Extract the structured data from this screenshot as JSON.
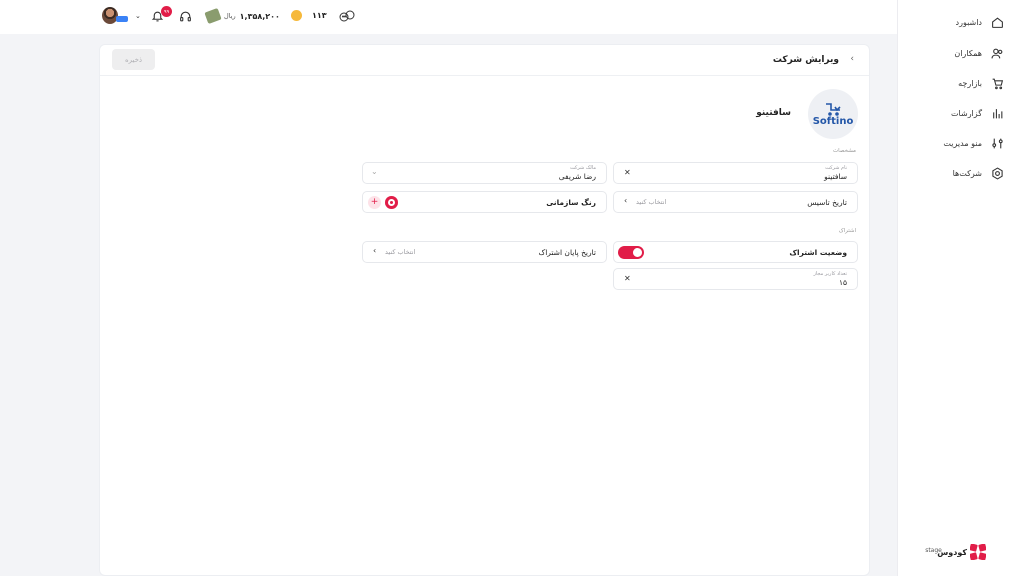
{
  "sidebar": {
    "items": [
      {
        "label": "داشبورد",
        "icon": "home-icon"
      },
      {
        "label": "همکاران",
        "icon": "users-icon"
      },
      {
        "label": "بازارچه",
        "icon": "cart-icon"
      },
      {
        "label": "گزارشات",
        "icon": "chart-icon"
      },
      {
        "label": "منو مدیریت",
        "icon": "sliders-icon"
      },
      {
        "label": "شرکت‌ها",
        "icon": "settings-icon"
      }
    ],
    "brand": "کودوس",
    "brand_tag": "stage"
  },
  "topbar": {
    "coins": "۱۱۳",
    "balance": "۱,۳۵۸,۲۰۰",
    "currency": "ریال",
    "notification_count": "۹۹"
  },
  "page": {
    "title": "ویرایش شرکت",
    "save_label": "ذخیره",
    "company_name": "سافتینو",
    "logo_text": "Softino",
    "section_details": "مشخصات",
    "section_subscription": "اشتراک"
  },
  "fields": {
    "company_name": {
      "label": "نام شرکت",
      "value": "سافتینو"
    },
    "owner": {
      "label": "مالک شرکت",
      "value": "رضا شریفی"
    },
    "founded": {
      "title": "تاریخ تاسیس",
      "placeholder": "انتخاب کنید"
    },
    "brand_color": {
      "title": "رنگ سازمانی",
      "color": "#e11d48"
    },
    "subscription_status": {
      "title": "وضعیت اشتراک",
      "enabled": true
    },
    "subscription_end": {
      "title": "تاریخ پایان اشتراک",
      "placeholder": "انتخاب کنید"
    },
    "user_limit": {
      "label": "تعداد کاربر مجاز",
      "value": "۱۵"
    }
  },
  "colors": {
    "accent": "#e11d48",
    "brand_blue": "#2457a8"
  }
}
